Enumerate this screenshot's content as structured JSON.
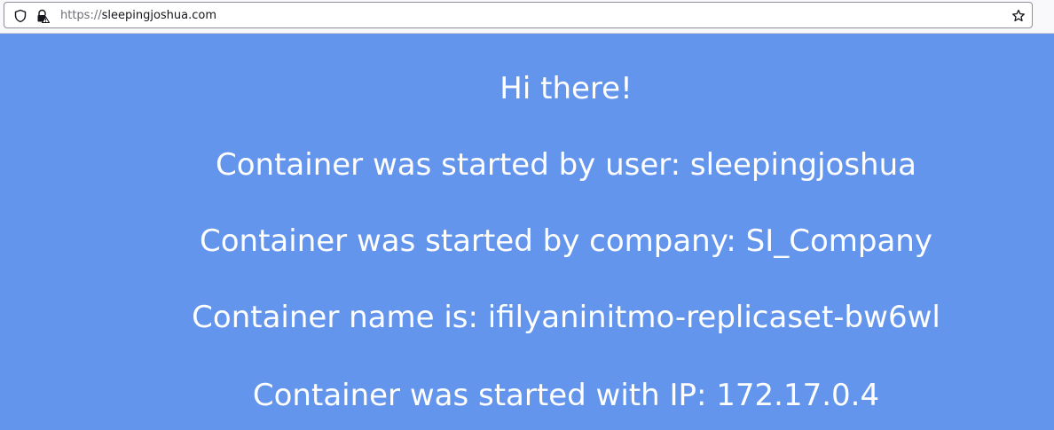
{
  "browser": {
    "url_scheme": "https://",
    "url_host": "sleepingjoshua.com",
    "icons": {
      "tracking": "shield-icon",
      "security": "lock-warning-icon",
      "bookmark": "star-icon"
    }
  },
  "page": {
    "background_color": "#6495ed",
    "text_color": "#ffffff",
    "greeting": "Hi there!",
    "user_line": "Container was started by user: sleepingjoshua",
    "company_line": "Container was started by company: SI_Company",
    "name_line": "Container name is: ifilyaninitmo-replicaset-bw6wl",
    "ip_line": "Container was started with IP: 172.17.0.4"
  }
}
